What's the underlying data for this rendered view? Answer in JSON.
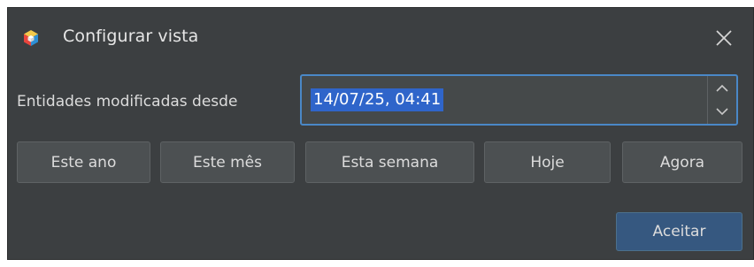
{
  "window": {
    "title": "Configurar vista",
    "app_icon": "app-logo-icon",
    "close_icon": "close-icon"
  },
  "form": {
    "label": "Entidades modificadas desde",
    "date_value": "14/07/25, 04:41",
    "spinner_icons": [
      "chevron-up-icon",
      "chevron-down-icon"
    ]
  },
  "quick_buttons": {
    "this_year": "Este ano",
    "this_month": "Este mês",
    "this_week": "Esta semana",
    "today": "Hoje",
    "now": "Agora"
  },
  "actions": {
    "accept": "Aceitar"
  },
  "colors": {
    "background": "#3c3f41",
    "field_border_focus": "#4a88c7",
    "selection": "#2f65ca",
    "primary_button": "#365880"
  }
}
